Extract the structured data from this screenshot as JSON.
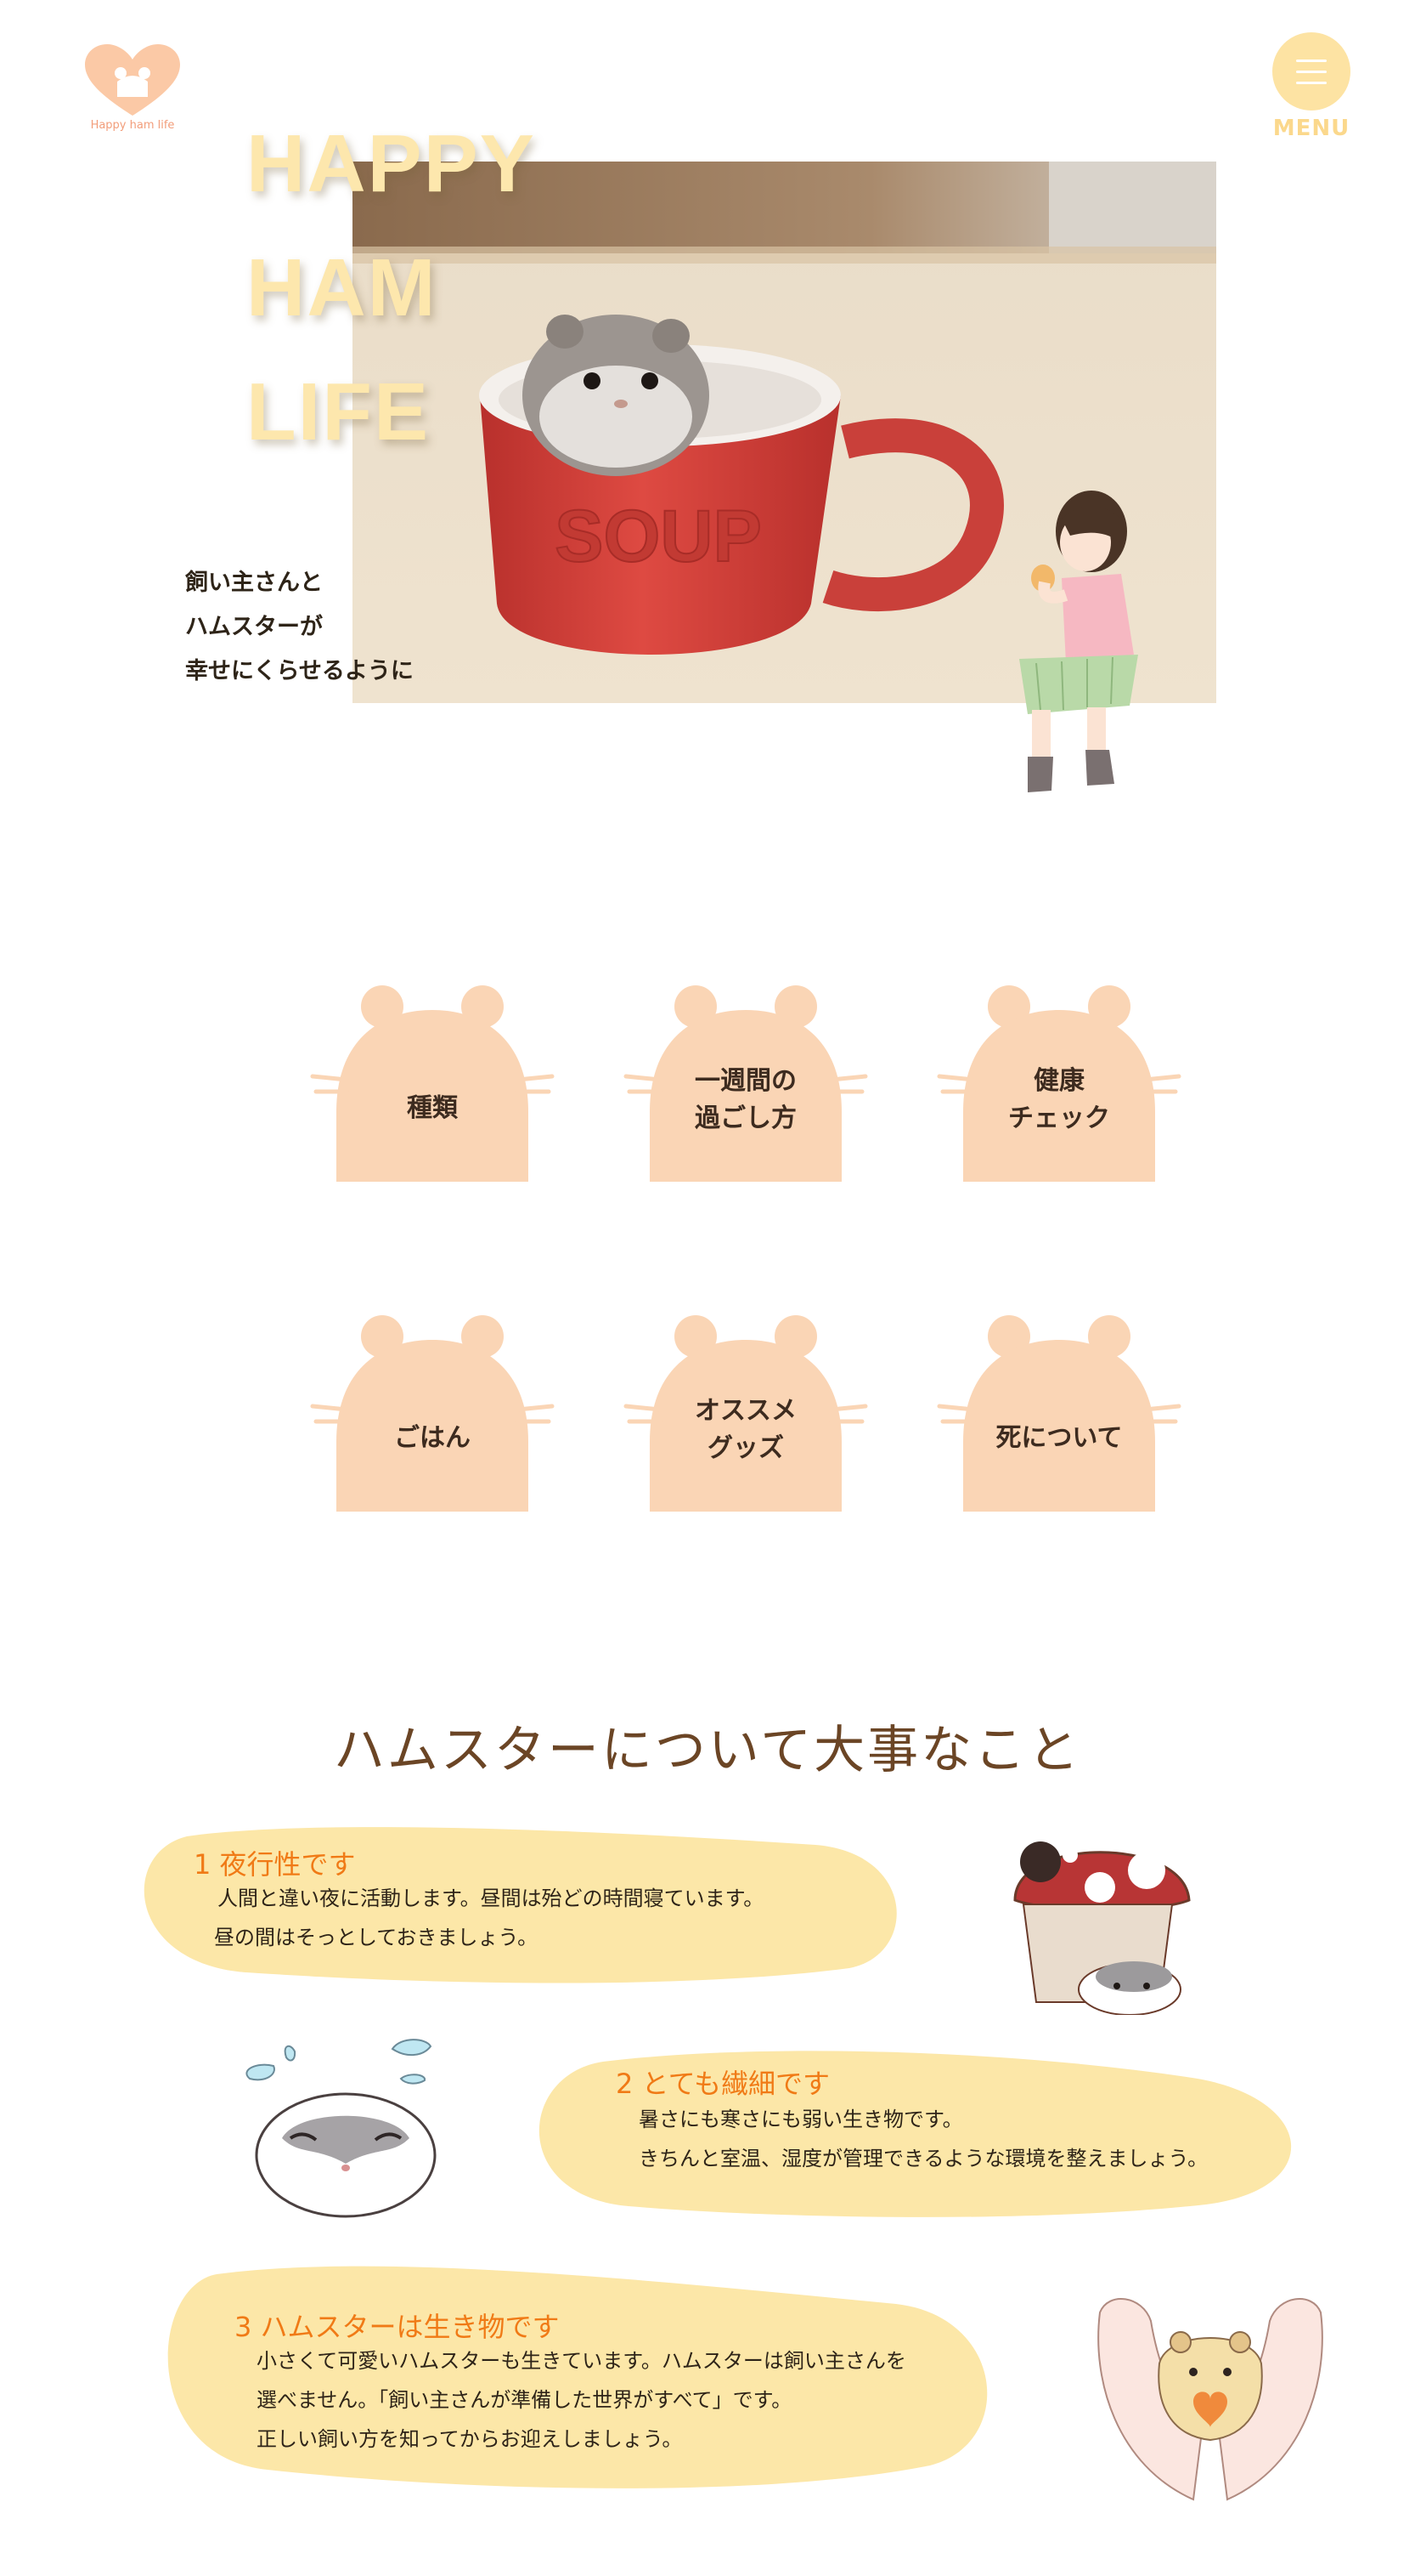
{
  "header": {
    "logo_text": "Happy ham life",
    "menu_label": "MENU"
  },
  "hero": {
    "title_lines": [
      "HAPPY",
      "HAM",
      "LIFE"
    ],
    "mug_text": "SOUP",
    "subtitle_lines": [
      "飼い主さんと",
      "ハムスターが",
      "幸せにくらせるように"
    ]
  },
  "nav": {
    "items": [
      {
        "label_lines": [
          "種類"
        ]
      },
      {
        "label_lines": [
          "一週間の",
          "過ごし方"
        ]
      },
      {
        "label_lines": [
          "健康",
          "チェック"
        ]
      },
      {
        "label_lines": [
          "ごはん"
        ]
      },
      {
        "label_lines": [
          "オススメ",
          "グッズ"
        ]
      },
      {
        "label_lines": [
          "死について"
        ]
      }
    ]
  },
  "important": {
    "title": "ハムスターについて大事なこと",
    "cards": [
      {
        "title": "1 夜行性です",
        "lines": [
          "人間と違い夜に活動します。昼間は殆どの時間寝ています。",
          "昼の間はそっとしておきましょう。"
        ]
      },
      {
        "title": "2 とても繊細です",
        "lines": [
          "暑さにも寒さにも弱い生き物です。",
          "きちんと室温、湿度が管理できるような環境を整えましょう。"
        ]
      },
      {
        "title": "3 ハムスターは生き物です",
        "lines": [
          "小さくて可愛いハムスターも生きています。ハムスターは飼い主さんを",
          "選べません。「飼い主さんが準備した世界がすべて」です。",
          "正しい飼い方を知ってからお迎えしましょう。"
        ]
      }
    ]
  },
  "colors": {
    "hamster_button": "#fad5b5",
    "blob": "#fce7a8",
    "title_accent": "#f07a16",
    "menu": "#fde3a3"
  }
}
